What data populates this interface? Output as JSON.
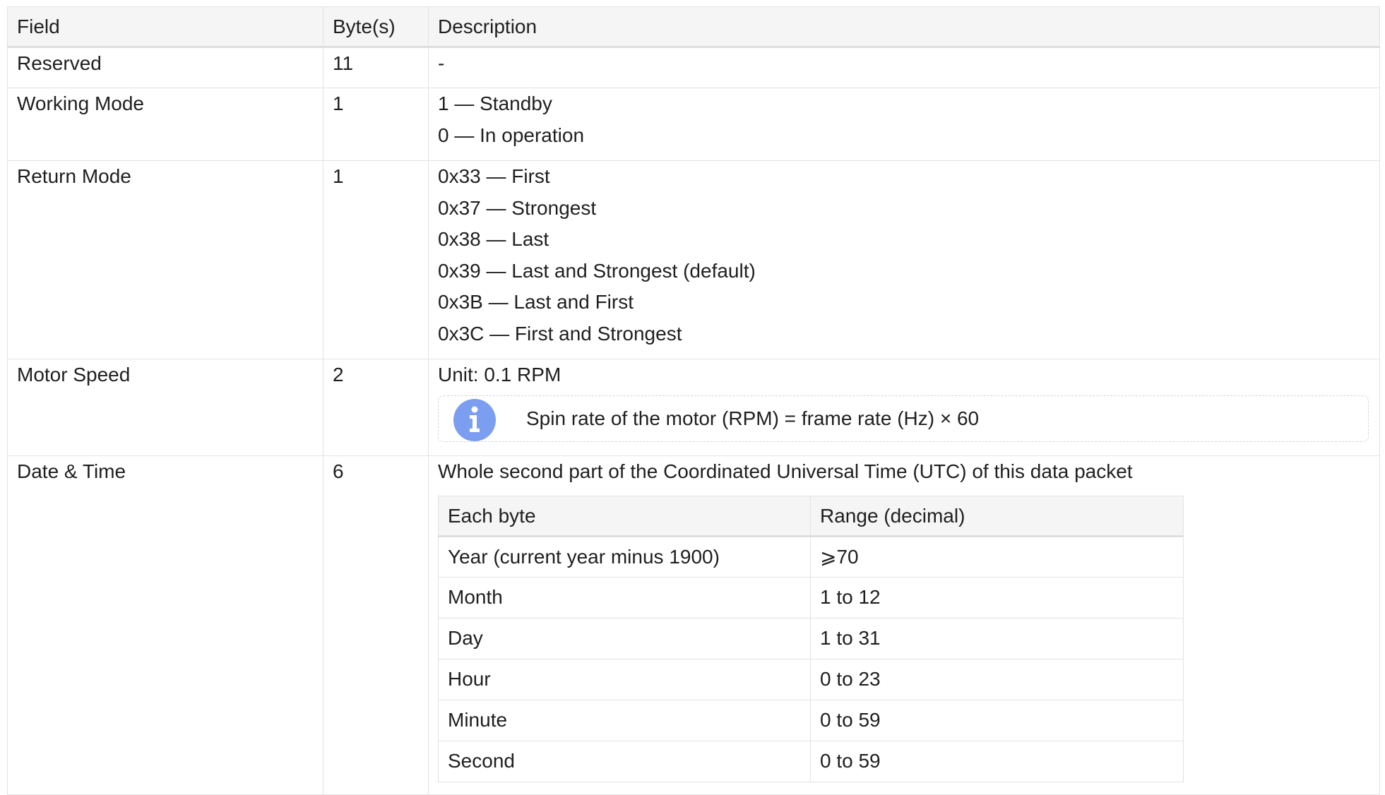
{
  "table": {
    "headers": {
      "field": "Field",
      "bytes": "Byte(s)",
      "description": "Description"
    },
    "rows": [
      {
        "field": "Reserved",
        "bytes": "11",
        "description": [
          "-"
        ]
      },
      {
        "field": "Working Mode",
        "bytes": "1",
        "description": [
          "1 — Standby",
          "0 — In operation"
        ]
      },
      {
        "field": "Return Mode",
        "bytes": "1",
        "description": [
          "0x33 — First",
          "0x37 — Strongest",
          "0x38 — Last",
          "0x39 — Last and Strongest (default)",
          "0x3B — Last and First",
          "0x3C — First and Strongest"
        ]
      },
      {
        "field": "Motor Speed",
        "bytes": "2",
        "description": [
          "Unit: 0.1 RPM"
        ],
        "note": {
          "icon": "info-icon",
          "text": "Spin rate of the motor (RPM) = frame rate (Hz) × 60"
        }
      },
      {
        "field": "Date & Time",
        "bytes": "6",
        "description": [
          "Whole second part of the Coordinated Universal Time (UTC) of this data packet"
        ],
        "subtable": {
          "headers": {
            "each_byte": "Each byte",
            "range": "Range (decimal)"
          },
          "rows": [
            {
              "each_byte": "Year (current year minus 1900)",
              "range": "⩾70"
            },
            {
              "each_byte": "Month",
              "range": "1 to 12"
            },
            {
              "each_byte": "Day",
              "range": "1 to 31"
            },
            {
              "each_byte": "Hour",
              "range": "0 to 23"
            },
            {
              "each_byte": "Minute",
              "range": "0 to 59"
            },
            {
              "each_byte": "Second",
              "range": "0 to 59"
            }
          ]
        }
      }
    ]
  },
  "colors": {
    "border": "#e3e3e3",
    "header_bg": "#f5f5f5",
    "info_icon": "#7b9ef0"
  }
}
